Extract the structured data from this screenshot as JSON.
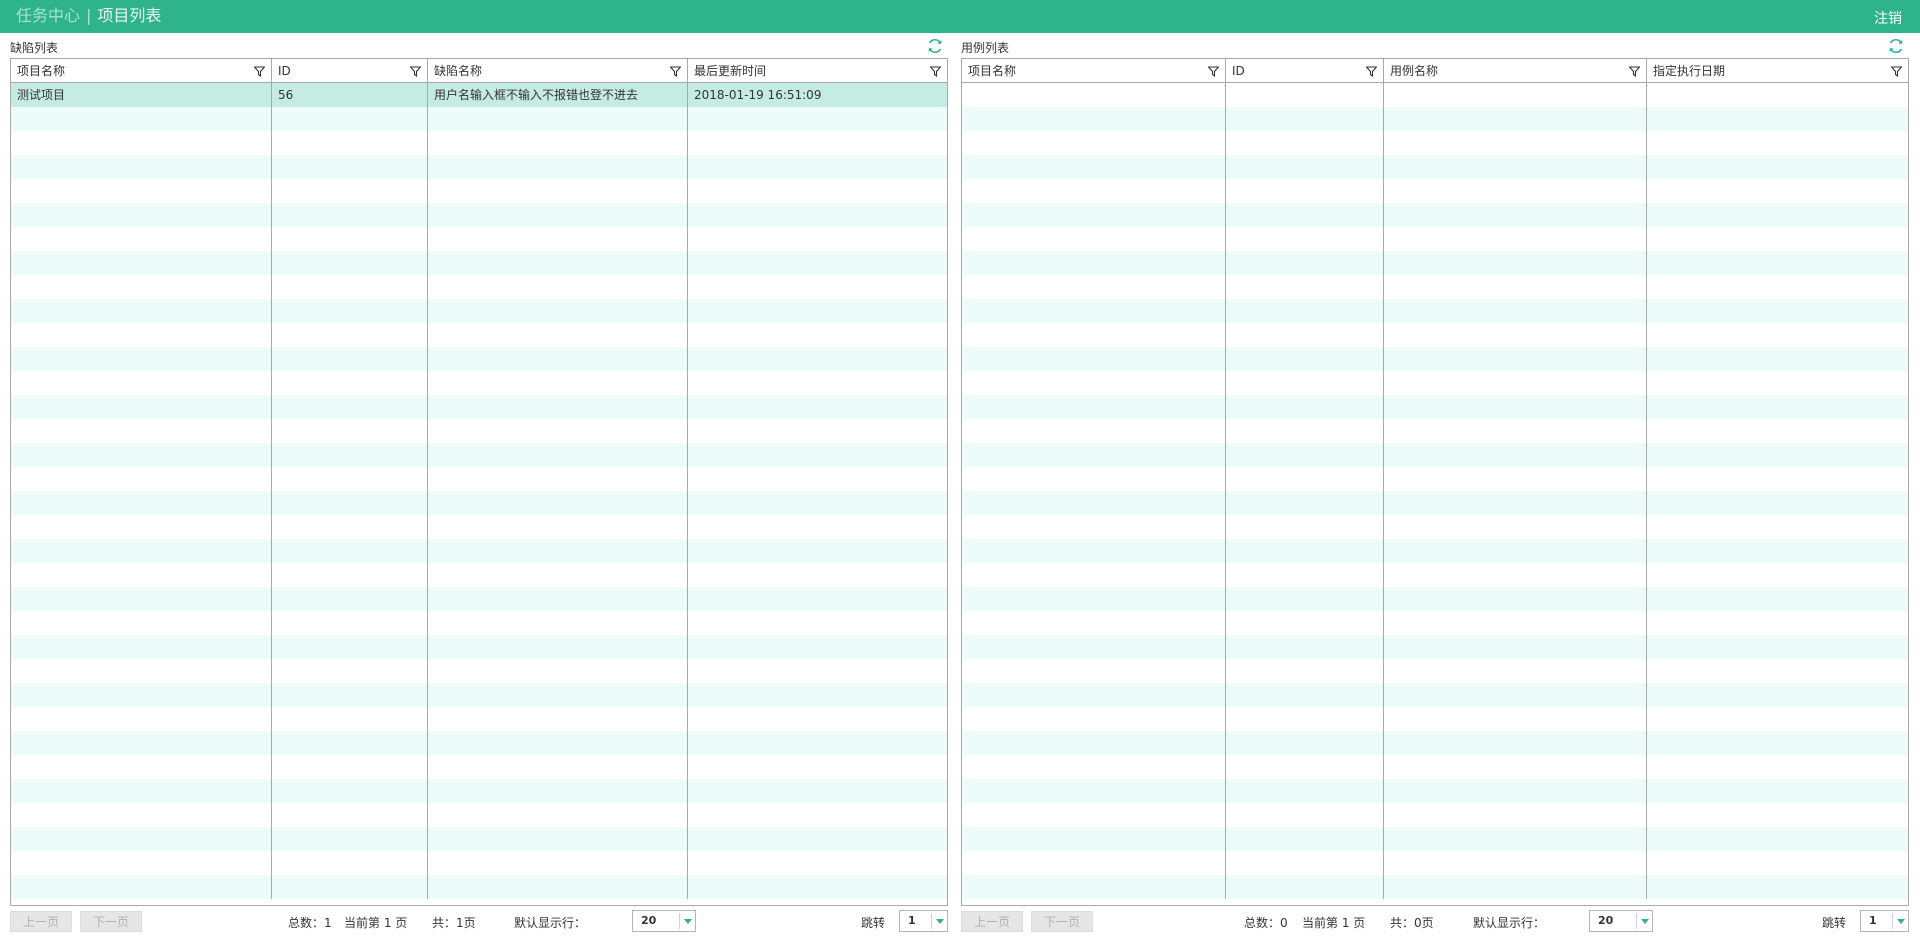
{
  "header": {
    "crumb_root": "任务中心",
    "crumb_sep": "|",
    "crumb_current": "项目列表",
    "logout_label": "注销"
  },
  "defect_panel": {
    "title": "缺陷列表",
    "columns": [
      "项目名称",
      "ID",
      "缺陷名称",
      "最后更新时间"
    ],
    "rows": [
      [
        "测试项目",
        "56",
        "用户名输入框不输入不报错也登不进去",
        "2018-01-19 16:51:09"
      ]
    ],
    "pager": {
      "prev_label": "上一页",
      "next_label": "下一页",
      "total": "总数：1",
      "current": "当前第 1 页",
      "pages": "共：1页",
      "rows_label": "默认显示行：",
      "rows_value": "20",
      "jump_label": "跳转",
      "jump_value": "1"
    }
  },
  "case_panel": {
    "title": "用例列表",
    "columns": [
      "项目名称",
      "ID",
      "用例名称",
      "指定执行日期"
    ],
    "rows": [],
    "pager": {
      "prev_label": "上一页",
      "next_label": "下一页",
      "total": "总数：0",
      "current": "当前第 1 页",
      "pages": "共：0页",
      "rows_label": "默认显示行：",
      "rows_value": "20",
      "jump_label": "跳转",
      "jump_value": "1"
    }
  },
  "colors": {
    "accent": "#2fb38a",
    "row_stripe": "#edfcfb",
    "row_selected": "#c5ece2"
  },
  "icons": {
    "refresh": "refresh-icon",
    "filter": "filter-icon",
    "dropdown": "chevron-down-icon"
  }
}
